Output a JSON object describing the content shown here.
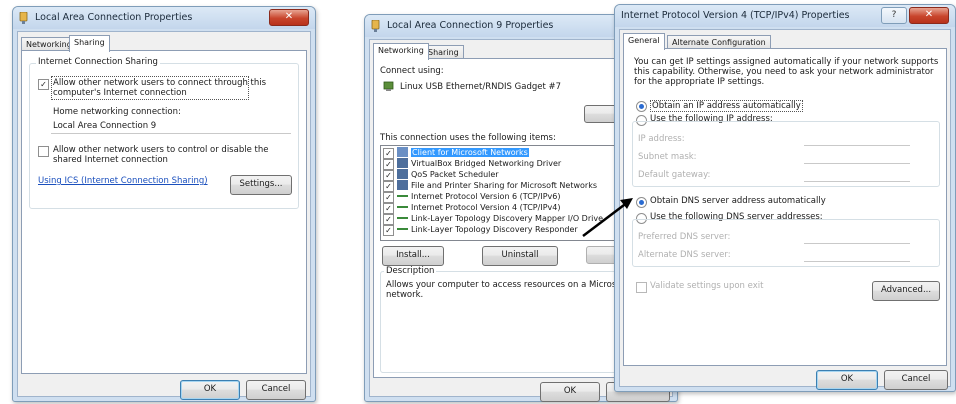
{
  "win1": {
    "title": "Local Area Connection Properties",
    "tabs": [
      "Networking",
      "Sharing"
    ],
    "group_title": "Internet Connection Sharing",
    "allow_connect": "Allow other network users to connect through this computer's Internet connection",
    "allow_connect_line1": "Allow other network users to connect through this",
    "allow_connect_line2": "computer's Internet connection",
    "home_label": "Home networking connection:",
    "home_value": "Local Area Connection 9",
    "allow_control_line1": "Allow other network users to control or disable the",
    "allow_control_line2": "shared Internet connection",
    "ics_link": "Using ICS (Internet Connection Sharing)",
    "settings_button": "Settings...",
    "ok_button": "OK",
    "cancel_button": "Cancel"
  },
  "win2": {
    "title": "Local Area Connection 9 Properties",
    "tabs": [
      "Networking",
      "Sharing"
    ],
    "connect_using": "Connect using:",
    "adapter": "Linux USB Ethernet/RNDIS Gadget #7",
    "configure_button": "Confi",
    "items_label": "This connection uses the following items:",
    "items": [
      {
        "label": "Client for Microsoft Networks",
        "checked": true,
        "selected": true
      },
      {
        "label": "VirtualBox Bridged Networking Driver",
        "checked": true
      },
      {
        "label": "QoS Packet Scheduler",
        "checked": true
      },
      {
        "label": "File and Printer Sharing for Microsoft Networks",
        "checked": true
      },
      {
        "label": "Internet Protocol Version 6 (TCP/IPv6)",
        "checked": true
      },
      {
        "label": "Internet Protocol Version 4 (TCP/IPv4)",
        "checked": true
      },
      {
        "label": "Link-Layer Topology Discovery Mapper I/O Drive",
        "checked": true
      },
      {
        "label": "Link-Layer Topology Discovery Responder",
        "checked": true
      }
    ],
    "install_button": "Install...",
    "uninstall_button": "Uninstall",
    "properties_button": "Prope",
    "description_title": "Description",
    "description_line1": "Allows your computer to access resources on a Micros",
    "description_line2": "network.",
    "ok_button": "OK"
  },
  "win3": {
    "title": "Internet Protocol Version 4 (TCP/IPv4) Properties",
    "help_button": "?",
    "close_button": "X",
    "tabs": [
      "General",
      "Alternate Configuration"
    ],
    "intro_line1": "You can get IP settings assigned automatically if your network supports",
    "intro_line2": "this capability. Otherwise, you need to ask your network administrator",
    "intro_line3": "for the appropriate IP settings.",
    "obtain_ip": "Obtain an IP address automatically",
    "use_ip": "Use the following IP address:",
    "ip_address": "IP address:",
    "subnet_mask": "Subnet mask:",
    "default_gateway": "Default gateway:",
    "obtain_dns": "Obtain DNS server address automatically",
    "use_dns": "Use the following DNS server addresses:",
    "preferred_dns": "Preferred DNS server:",
    "alternate_dns": "Alternate DNS server:",
    "validate": "Validate settings upon exit",
    "advanced_button": "Advanced...",
    "ok_button": "OK",
    "cancel_button": "Cancel"
  },
  "colors": {
    "selection": "#3399ff",
    "link": "#1a4fbd",
    "close": "#c8452c",
    "arrow": "#000000"
  }
}
